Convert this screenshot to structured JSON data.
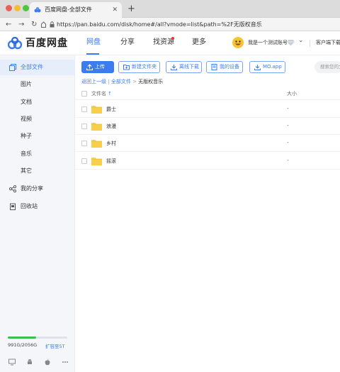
{
  "window": {
    "tab_title": "百度网盘-全部文件",
    "url": "https://pan.baidu.com/disk/home#/all?vmode=list&path=%2F无版权音乐"
  },
  "header": {
    "logo_text": "百度网盘",
    "nav": [
      {
        "label": "网盘",
        "active": true
      },
      {
        "label": "分享",
        "active": false
      },
      {
        "label": "找资源",
        "active": false
      },
      {
        "label": "更多",
        "active": false
      }
    ],
    "account_name": "我是一个测试账号",
    "client_download": "客户端下载"
  },
  "sidebar": {
    "items": [
      {
        "label": "全部文件",
        "icon": "files-icon",
        "active": true
      },
      {
        "label": "图片"
      },
      {
        "label": "文档"
      },
      {
        "label": "视频"
      },
      {
        "label": "种子"
      },
      {
        "label": "音乐"
      },
      {
        "label": "其它"
      },
      {
        "label": "我的分享",
        "icon": "share-icon"
      },
      {
        "label": "回收站",
        "icon": "recycle-bin-icon"
      }
    ],
    "quota_text": "991G/2056G",
    "quota_used_fraction": 0.48,
    "expand_label": "扩容至5T"
  },
  "toolbar": {
    "upload": "上传",
    "new_folder": "新建文件夹",
    "offline_download": "离线下载",
    "my_devices": "我的设备",
    "mo_app": "MO.app",
    "search_placeholder": "搜索您的文件"
  },
  "breadcrumb": {
    "back": "返回上一级",
    "root": "全部文件",
    "separator": ">",
    "current": "无版权音乐"
  },
  "table": {
    "col_name": "文件名",
    "sort_arrow": "↑",
    "col_size": "大小",
    "rows": [
      {
        "name": "爵士",
        "size": "-"
      },
      {
        "name": "浪漫",
        "size": "-"
      },
      {
        "name": "乡村",
        "size": "-"
      },
      {
        "name": "摇滚",
        "size": "-"
      }
    ]
  },
  "colors": {
    "accent": "#3b7cf0",
    "quota_fill": "#3dbf4e",
    "folder": "#f8cf4a"
  }
}
